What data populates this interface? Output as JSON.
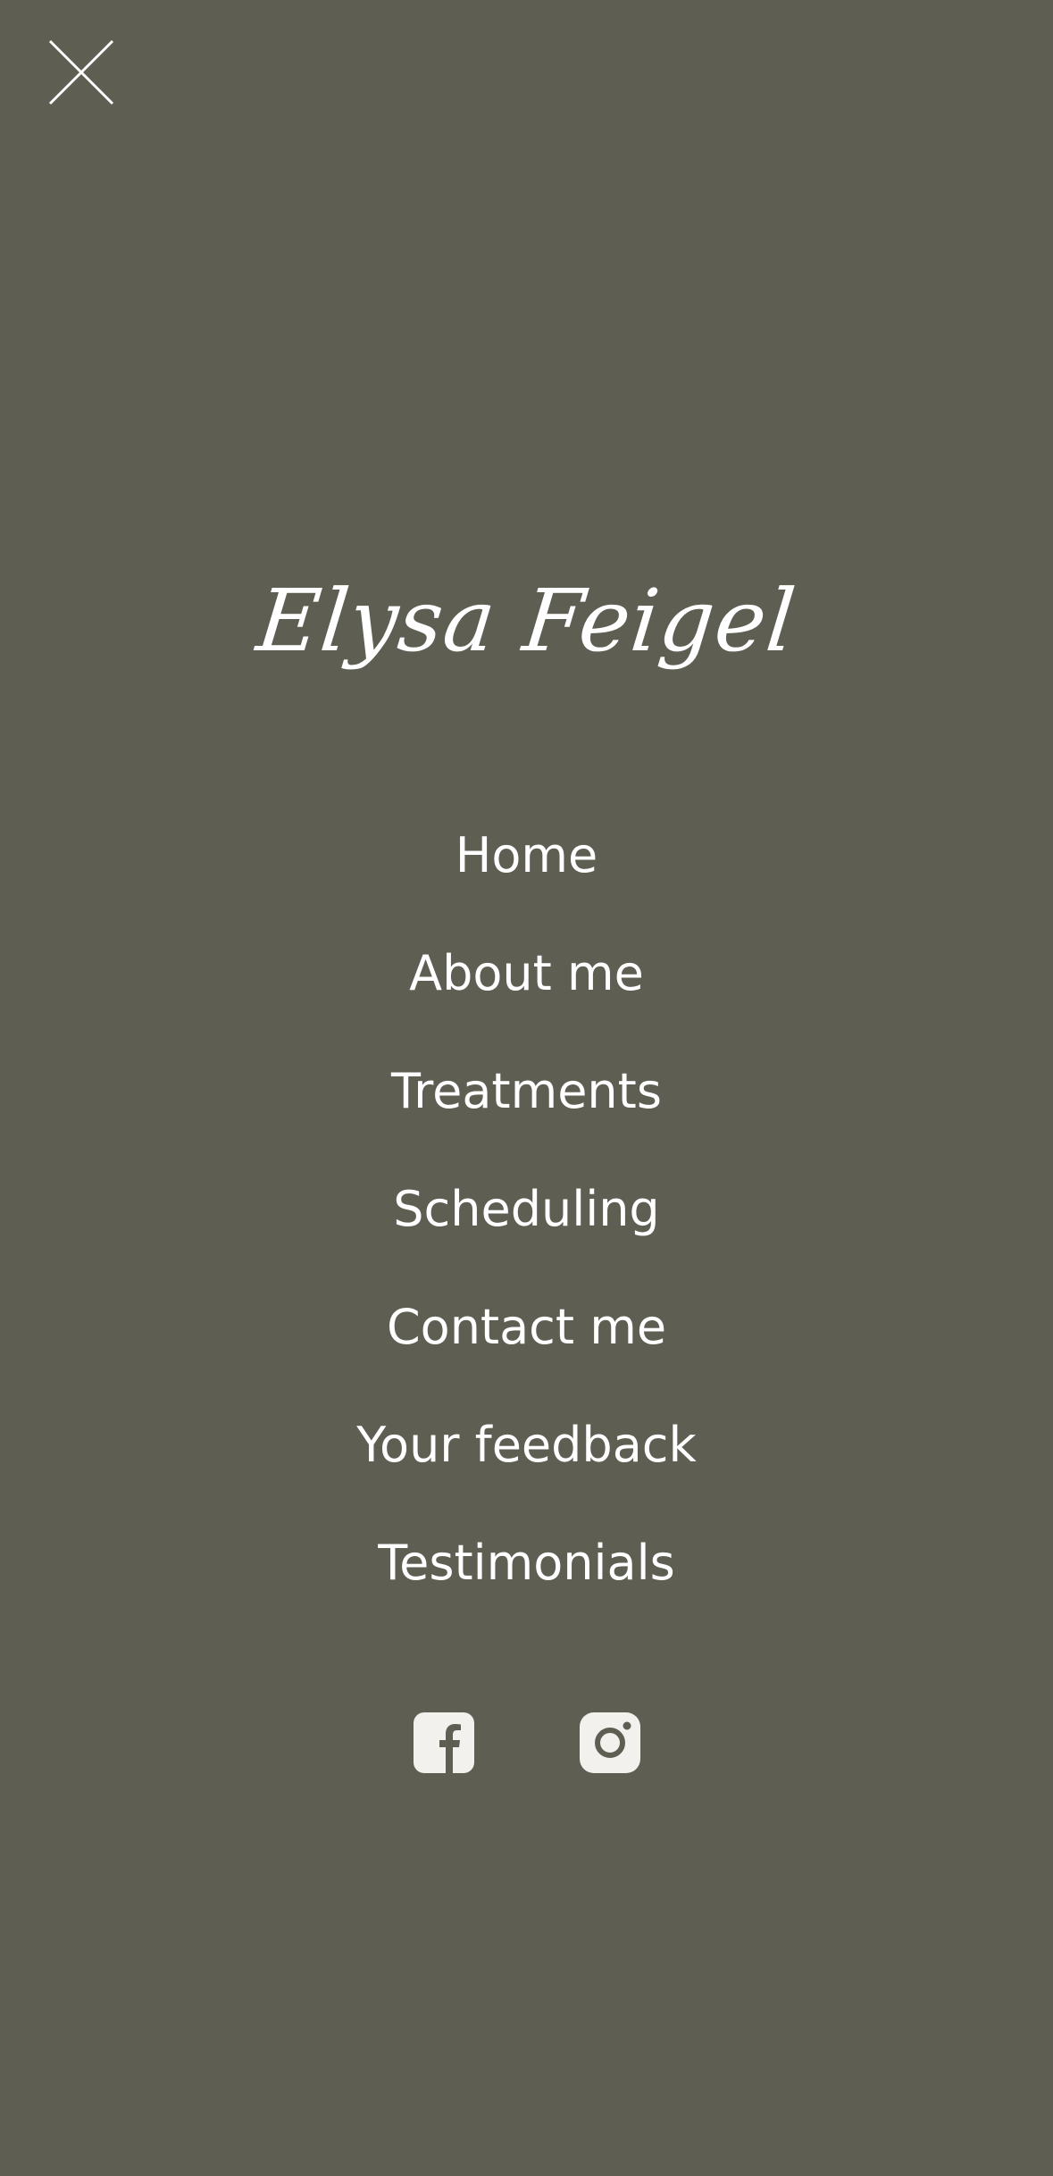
{
  "colors": {
    "background": "#5e5e53",
    "text": "#ffffff",
    "icon_fill": "#f2f1ed"
  },
  "header": {
    "close_icon": "close-icon"
  },
  "brand": {
    "name": "Elysa Feigel"
  },
  "menu": {
    "items": [
      {
        "label": "Home"
      },
      {
        "label": "About me"
      },
      {
        "label": "Treatments"
      },
      {
        "label": "Scheduling"
      },
      {
        "label": "Contact me"
      },
      {
        "label": "Your feedback"
      },
      {
        "label": "Testimonials"
      }
    ]
  },
  "social": {
    "icons": [
      "facebook-icon",
      "instagram-icon"
    ]
  }
}
